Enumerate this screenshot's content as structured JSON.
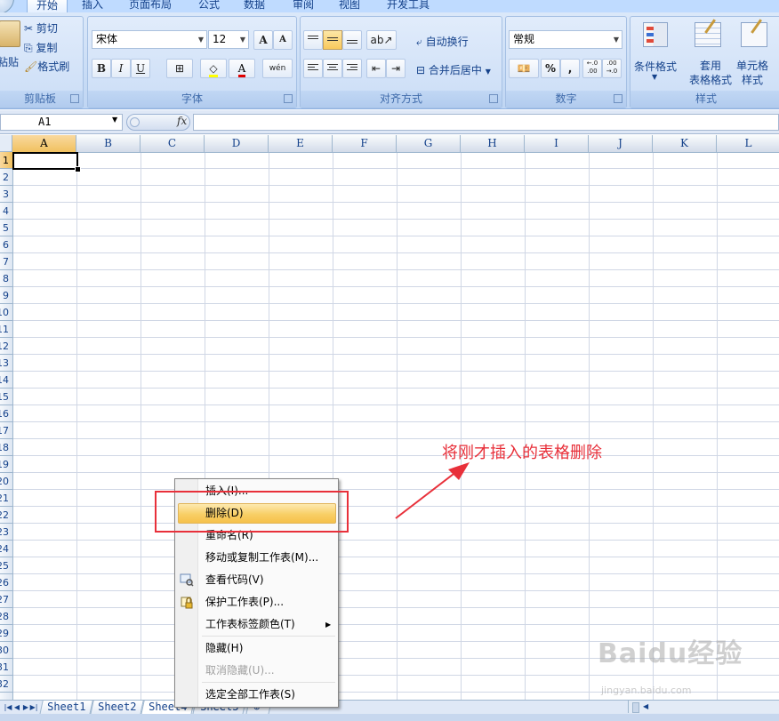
{
  "ribbon": {
    "tabs": [
      "开始",
      "插入",
      "页面布局",
      "公式",
      "数据",
      "审阅",
      "视图",
      "开发工具"
    ],
    "active_tab": "开始",
    "clipboard": {
      "paste": "粘贴",
      "cut": "剪切",
      "copy": "复制",
      "format_painter": "格式刷",
      "group": "剪贴板"
    },
    "font": {
      "name": "宋体",
      "size": "12",
      "bold": "B",
      "italic": "I",
      "underline": "U",
      "font_color": "A",
      "phonetic": "wén",
      "grow": "A",
      "shrink": "A",
      "group": "字体"
    },
    "alignment": {
      "wrap_text": "自动换行",
      "merge_center": "合并后居中",
      "group": "对齐方式"
    },
    "number": {
      "format": "常规",
      "percent": "%",
      "comma": ",",
      "inc_decimal": "←.0 .00",
      "dec_decimal": ".00 →.0",
      "group": "数字"
    },
    "styles": {
      "conditional": "条件格式",
      "table_format": "套用\n表格格式",
      "cell_styles": "单元格\n样式",
      "group": "样式"
    }
  },
  "formula_bar": {
    "name_box": "A1",
    "fx": "fx",
    "value": ""
  },
  "grid": {
    "columns": [
      "A",
      "B",
      "C",
      "D",
      "E",
      "F",
      "G",
      "H",
      "I",
      "J",
      "K",
      "L"
    ],
    "rows": [
      "1",
      "2",
      "3",
      "4",
      "5",
      "6",
      "7",
      "8",
      "9",
      "10",
      "11",
      "12",
      "13",
      "14",
      "15",
      "16",
      "17",
      "18",
      "19",
      "20",
      "21",
      "22",
      "23",
      "24",
      "25",
      "26",
      "27",
      "28",
      "29",
      "30",
      "31",
      "32"
    ],
    "active_cell": "A1"
  },
  "sheet_tabs": [
    "Sheet1",
    "Sheet2",
    "Sheet4",
    "Sheet3"
  ],
  "context_menu": {
    "items": [
      {
        "label": "插入(I)...",
        "state": "normal"
      },
      {
        "label": "删除(D)",
        "state": "highlighted"
      },
      {
        "label": "重命名(R)",
        "state": "normal"
      },
      {
        "label": "移动或复制工作表(M)...",
        "state": "normal"
      },
      {
        "label": "查看代码(V)",
        "state": "normal",
        "icon": "view-code-icon"
      },
      {
        "label": "保护工作表(P)...",
        "state": "normal",
        "icon": "lock-icon"
      },
      {
        "label": "工作表标签颜色(T)",
        "state": "normal",
        "submenu": true
      },
      {
        "label": "隐藏(H)",
        "state": "normal"
      },
      {
        "label": "取消隐藏(U)...",
        "state": "disabled"
      },
      {
        "label": "选定全部工作表(S)",
        "state": "normal"
      }
    ]
  },
  "annotation": {
    "text": "将刚才插入的表格删除",
    "color": "#e8303a"
  },
  "watermark": {
    "brand": "Baidu经验",
    "url": "jingyan.baidu.com"
  }
}
